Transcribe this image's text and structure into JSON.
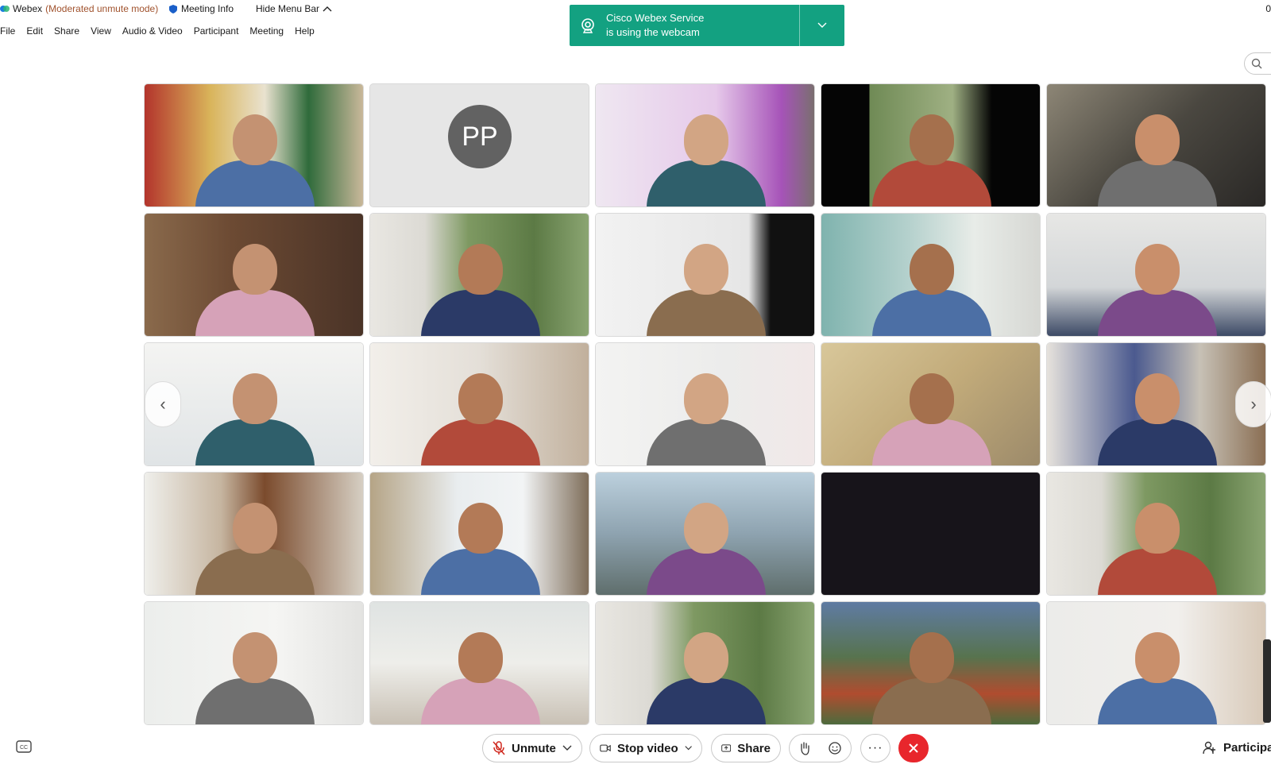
{
  "titlebar": {
    "app_name": "Webex",
    "mode": "(Moderated unmute mode)",
    "meeting_info": "Meeting Info",
    "hide_menu_bar": "Hide Menu Bar",
    "right_glyph": "0"
  },
  "menubar": {
    "items": [
      "File",
      "Edit",
      "Share",
      "View",
      "Audio & Video",
      "Participant",
      "Meeting",
      "Help"
    ]
  },
  "notification": {
    "line1": "Cisco Webex Service",
    "line2": "is using the webcam",
    "color": "#13a181"
  },
  "grid": {
    "avatar_initials": "PP",
    "tiles": [
      {
        "kind": "video",
        "bg": "office-scarves"
      },
      {
        "kind": "avatar"
      },
      {
        "kind": "video",
        "bg": "purple-banner"
      },
      {
        "kind": "video",
        "bg": "trees-dark"
      },
      {
        "kind": "video",
        "bg": "dim-office"
      },
      {
        "kind": "video",
        "bg": "wood-office"
      },
      {
        "kind": "video",
        "bg": "trees-room"
      },
      {
        "kind": "video",
        "bg": "white-black"
      },
      {
        "kind": "video",
        "bg": "teal-room"
      },
      {
        "kind": "video",
        "bg": "board-room"
      },
      {
        "kind": "video",
        "bg": "bright-office"
      },
      {
        "kind": "video",
        "bg": "window-room"
      },
      {
        "kind": "video",
        "bg": "conference-wall"
      },
      {
        "kind": "video",
        "bg": "blur-warm"
      },
      {
        "kind": "video",
        "bg": "poster-room"
      },
      {
        "kind": "video",
        "bg": "bookshelf"
      },
      {
        "kind": "video",
        "bg": "screen-room"
      },
      {
        "kind": "video",
        "bg": "sky-blur"
      },
      {
        "kind": "video",
        "bg": "black"
      },
      {
        "kind": "video",
        "bg": "trees-room"
      },
      {
        "kind": "video",
        "bg": "white-room"
      },
      {
        "kind": "video",
        "bg": "window-lab"
      },
      {
        "kind": "video",
        "bg": "trees-room"
      },
      {
        "kind": "video",
        "bg": "aerial"
      },
      {
        "kind": "video",
        "bg": "art-wall"
      }
    ]
  },
  "controls": {
    "unmute": "Unmute",
    "stop_video": "Stop video",
    "share": "Share",
    "participants": "Participa",
    "end_color": "#e8262c"
  }
}
